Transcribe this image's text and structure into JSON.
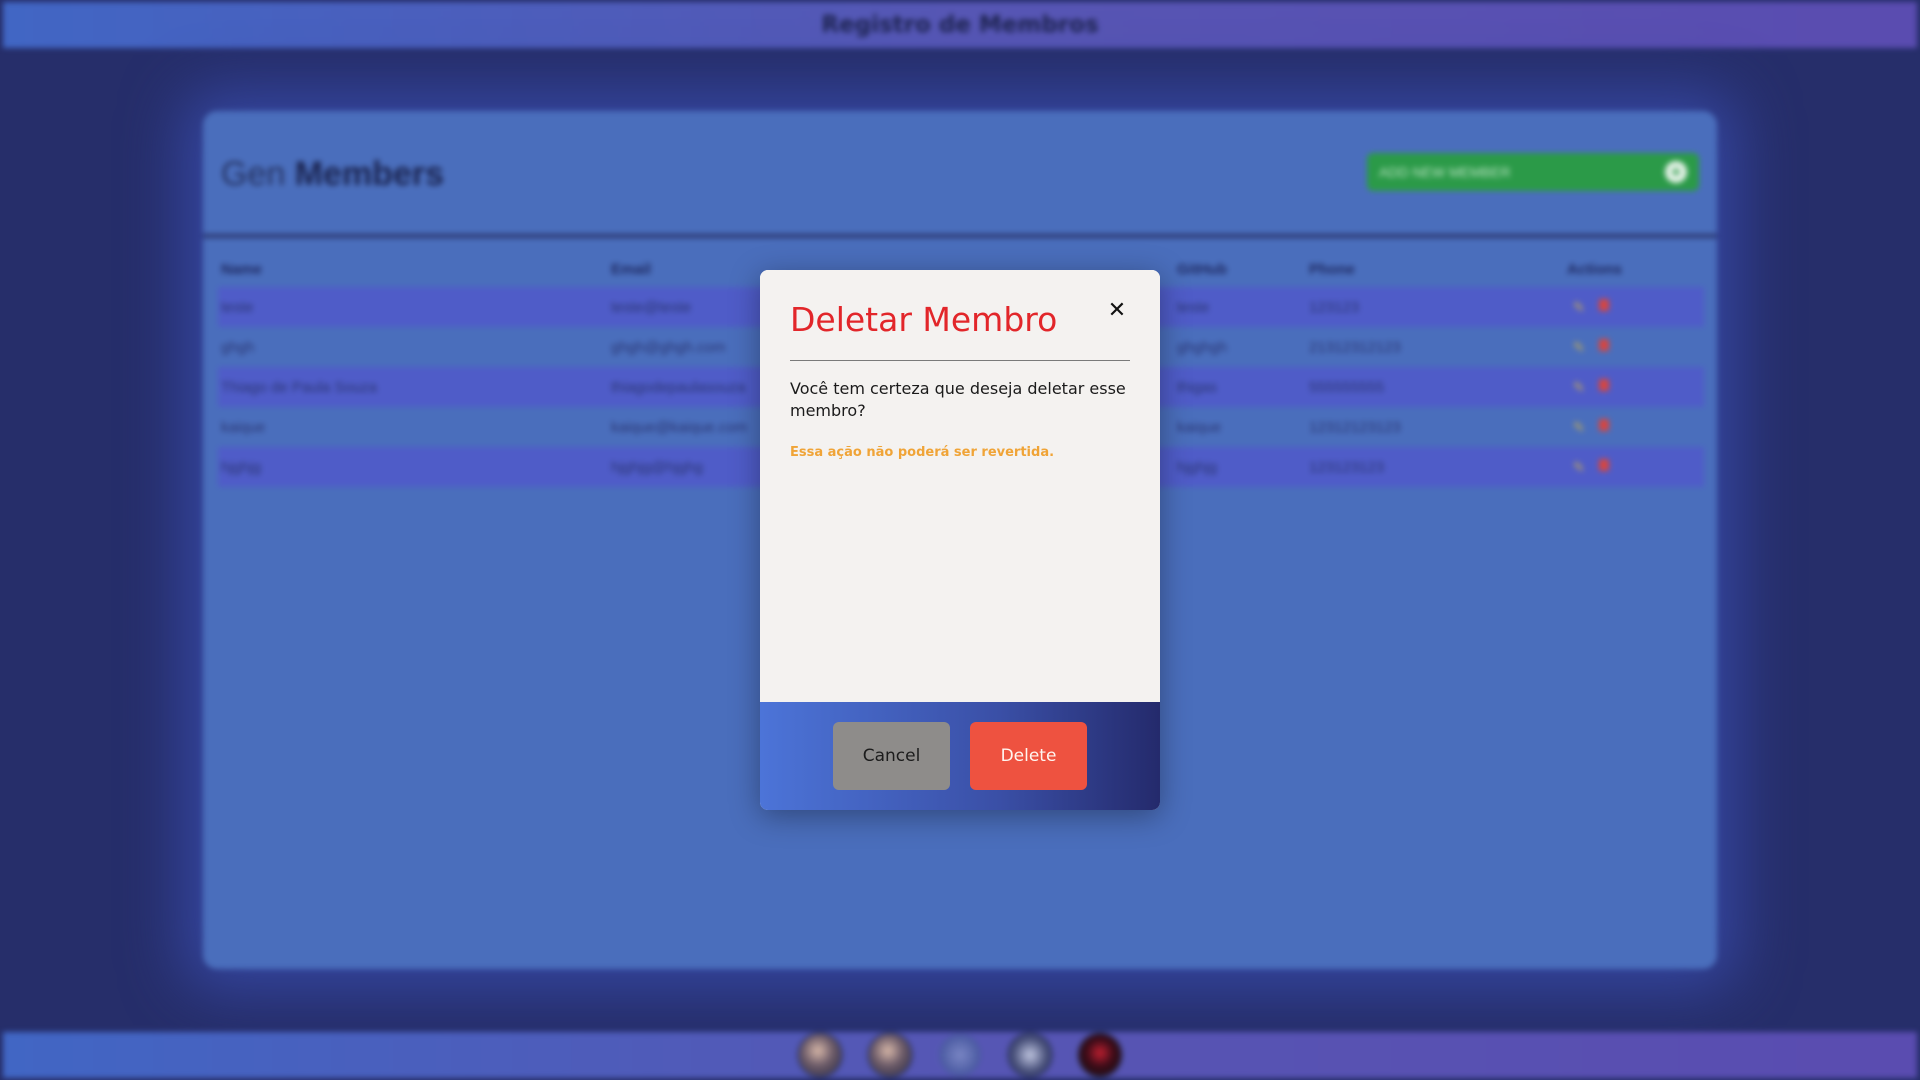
{
  "app": {
    "title": "Registro de Membros"
  },
  "page": {
    "title_light": "Gen",
    "title_bold": "Members",
    "add_button_label": "ADD NEW MEMBER"
  },
  "table": {
    "headers": [
      "Name",
      "Email",
      "GitHub",
      "Phone",
      "Actions"
    ],
    "rows": [
      {
        "name": "teste",
        "email": "teste@teste",
        "github": "teste",
        "phone": "123123"
      },
      {
        "name": "ghgh",
        "email": "ghgh@ghgh.com",
        "github": "ghghgh",
        "phone": "21312312123"
      },
      {
        "name": "Thiago de Paula Souza",
        "email": "thiagodepaulasouza",
        "github": "thigas",
        "phone": "555555555"
      },
      {
        "name": "kaique",
        "email": "kaique@kaique.com",
        "github": "kaique",
        "phone": "12312123123"
      },
      {
        "name": "hjghjg",
        "email": "hjghjg@hjghg",
        "github": "hjghjg",
        "phone": "123123123"
      }
    ]
  },
  "modal": {
    "title": "Deletar Membro",
    "close_icon": "close-icon",
    "message": "Você tem certeza que deseja deletar esse membro?",
    "warning": "Essa ação não poderá ser revertida.",
    "cancel_label": "Cancel",
    "delete_label": "Delete"
  },
  "footer": {
    "social_icons": [
      "avatar-1",
      "avatar-2",
      "logo-3",
      "avatar-4",
      "avatar-5"
    ]
  },
  "colors": {
    "modal_title": "#e2262a",
    "warning": "#f0a437",
    "delete_button": "#ee5240",
    "cancel_button": "#8e8c8a",
    "add_button": "#2b9a48"
  }
}
